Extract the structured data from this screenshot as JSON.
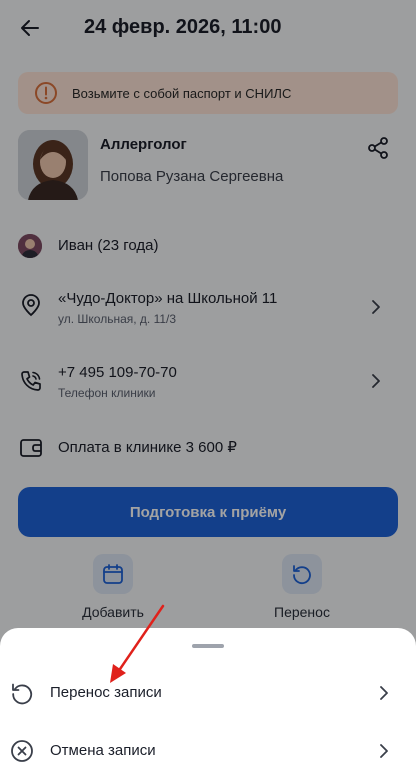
{
  "header": {
    "back_icon": "arrow-left-icon",
    "title": "24 февр. 2026, 11:00"
  },
  "notice": {
    "icon": "exclamation-circle-icon",
    "text": "Возьмите с собой паспорт и СНИЛС",
    "background": "#fde3d6",
    "icon_color": "#d9713d"
  },
  "doctor": {
    "specialty": "Аллерголог",
    "name": "Попова Рузана Сергеевна",
    "share_icon": "share-icon"
  },
  "patient": {
    "label": "Иван (23 года)"
  },
  "clinic": {
    "icon": "location-pin-icon",
    "title": "«Чудо-Доктор» на Школьной 11",
    "address": "ул. Школьная, д. 11/3"
  },
  "phone": {
    "icon": "phone-icon",
    "number": "+7 495 109-70-70",
    "caption": "Телефон клиники"
  },
  "payment": {
    "icon": "wallet-icon",
    "text": "Оплата в клинике 3 600 ₽"
  },
  "prepare_button": {
    "label": "Подготовка к приёму",
    "color": "#1e63d8"
  },
  "actions": [
    {
      "icon": "calendar-icon",
      "label": "Добавить"
    },
    {
      "icon": "reschedule-icon",
      "label": "Перенос"
    }
  ],
  "sheet": {
    "items": [
      {
        "icon": "reschedule-icon",
        "label": "Перенос записи"
      },
      {
        "icon": "cancel-circle-icon",
        "label": "Отмена записи"
      }
    ]
  },
  "annotation": {
    "arrow_color": "#e0211b"
  }
}
